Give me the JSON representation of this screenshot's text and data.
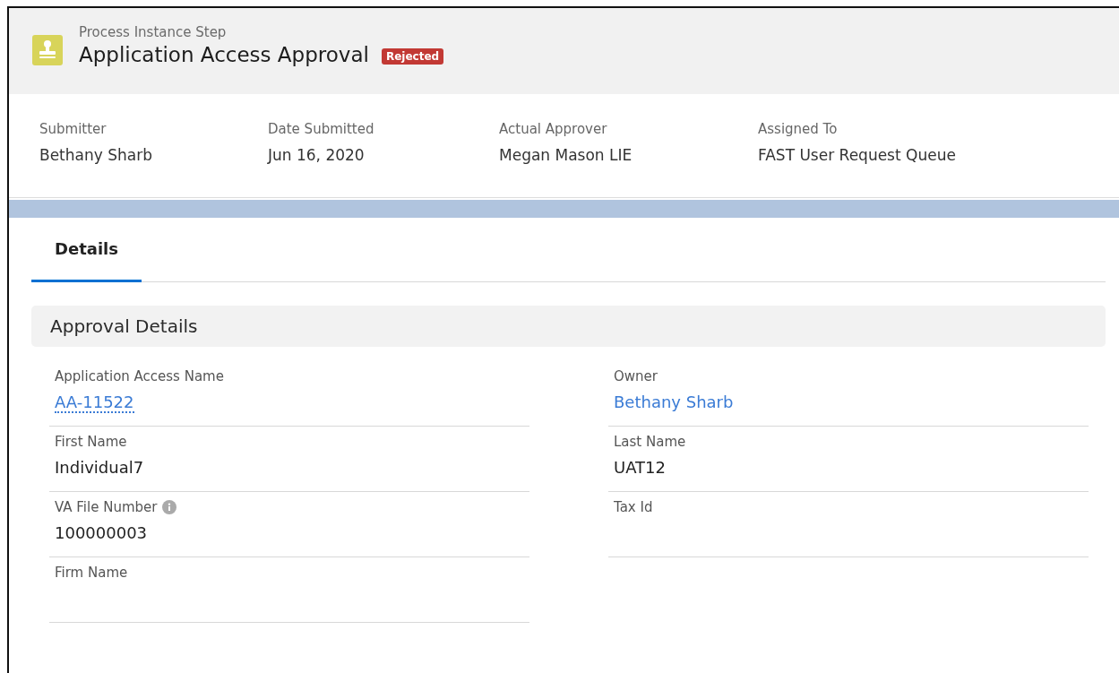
{
  "header": {
    "object_type": "Process Instance Step",
    "title": "Application Access Approval",
    "badge": "Rejected"
  },
  "highlights": [
    {
      "label": "Submitter",
      "value": "Bethany Sharb"
    },
    {
      "label": "Date Submitted",
      "value": "Jun 16, 2020"
    },
    {
      "label": "Actual Approver",
      "value": "Megan Mason LIE"
    },
    {
      "label": "Assigned To",
      "value": "FAST User Request Queue"
    }
  ],
  "tabs": [
    {
      "label": "Details",
      "selected": true
    }
  ],
  "section": {
    "title": "Approval Details"
  },
  "rows": [
    {
      "fields": [
        {
          "label": "Application Access Name",
          "value": "AA-11522",
          "kind": "record-link",
          "info": false
        },
        {
          "label": "Owner",
          "value": "Bethany Sharb",
          "kind": "user-link",
          "info": false
        }
      ]
    },
    {
      "fields": [
        {
          "label": "First Name",
          "value": "Individual7",
          "kind": "text",
          "info": false
        },
        {
          "label": "Last Name",
          "value": "UAT12",
          "kind": "text",
          "info": false
        }
      ]
    },
    {
      "fields": [
        {
          "label": "VA File Number",
          "value": "100000003",
          "kind": "text",
          "info": true
        },
        {
          "label": "Tax Id",
          "info": false
        }
      ]
    },
    {
      "fields": [
        {
          "label": "Firm Name",
          "info": false
        }
      ]
    }
  ]
}
